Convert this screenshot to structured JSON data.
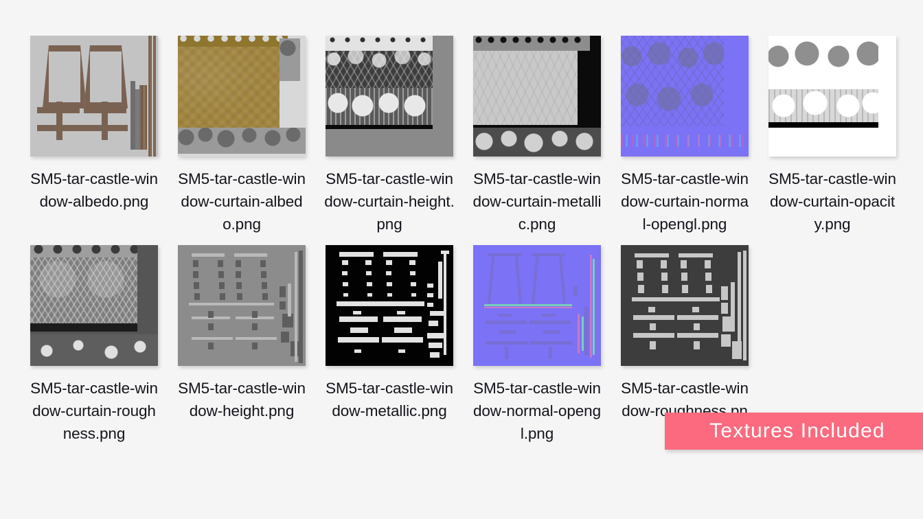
{
  "background_color": "#f5f5f5",
  "file_grid": {
    "columns": 6,
    "rows": 2,
    "items": [
      {
        "label": "SM5-tar-castle-window-albedo.png",
        "thumbnail": "albedo-map-thumbnail",
        "row": 1,
        "column": 1
      },
      {
        "label": "SM5-tar-castle-window-curtain-albedo.png",
        "thumbnail": "curtain-albedo-map-thumbnail",
        "row": 1,
        "column": 2
      },
      {
        "label": "SM5-tar-castle-window-curtain-height.png",
        "thumbnail": "curtain-height-map-thumbnail",
        "row": 1,
        "column": 3
      },
      {
        "label": "SM5-tar-castle-window-curtain-metallic.png",
        "thumbnail": "curtain-metallic-map-thumbnail",
        "row": 1,
        "column": 4
      },
      {
        "label": "SM5-tar-castle-window-curtain-normal-opengl.png",
        "thumbnail": "curtain-normal-map-thumbnail",
        "row": 1,
        "column": 5
      },
      {
        "label": "SM5-tar-castle-window-curtain-opacity.png",
        "thumbnail": "curtain-opacity-map-thumbnail",
        "row": 1,
        "column": 6
      },
      {
        "label": "SM5-tar-castle-window-curtain-roughness.png",
        "thumbnail": "curtain-roughness-map-thumbnail",
        "row": 2,
        "column": 1
      },
      {
        "label": "SM5-tar-castle-window-height.png",
        "thumbnail": "height-map-thumbnail",
        "row": 2,
        "column": 2
      },
      {
        "label": "SM5-tar-castle-window-metallic.png",
        "thumbnail": "metallic-map-thumbnail",
        "row": 2,
        "column": 3
      },
      {
        "label": "SM5-tar-castle-window-normal-opengl.png",
        "thumbnail": "normal-map-thumbnail",
        "row": 2,
        "column": 4
      },
      {
        "label": "SM5-tar-castle-window-roughness.png",
        "thumbnail": "roughness-map-thumbnail",
        "row": 2,
        "column": 5
      }
    ]
  },
  "banner": {
    "text": "Textures Included",
    "background_color": "#fb6a7e",
    "text_color": "#ffffff"
  }
}
